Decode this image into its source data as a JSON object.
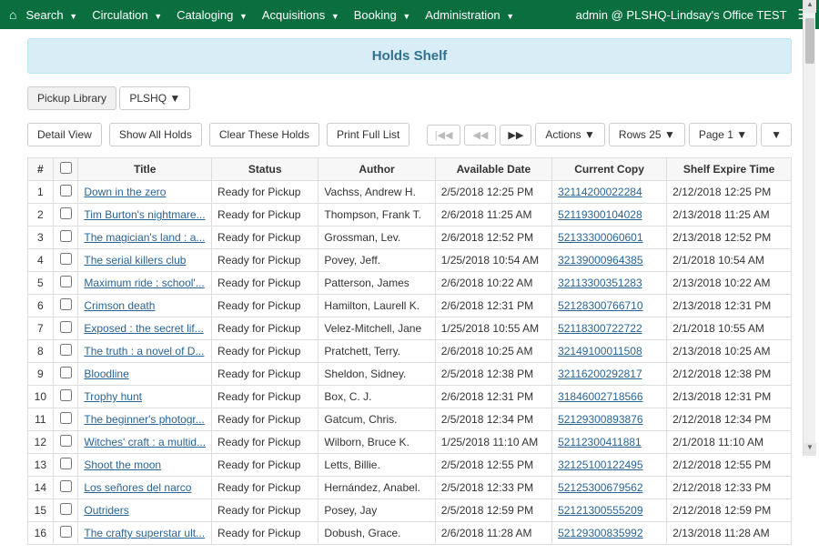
{
  "nav": {
    "items": [
      "Search",
      "Circulation",
      "Cataloging",
      "Acquisitions",
      "Booking",
      "Administration"
    ],
    "user_info": "admin @ PLSHQ-Lindsay's Office TEST"
  },
  "page_title": "Holds Shelf",
  "library_picker": {
    "label": "Pickup Library",
    "value": "PLSHQ"
  },
  "toolbar": {
    "detail_view": "Detail View",
    "show_all": "Show All Holds",
    "clear": "Clear These Holds",
    "print": "Print Full List",
    "actions": "Actions",
    "rows": "Rows 25",
    "page": "Page 1"
  },
  "columns": {
    "num": "#",
    "title": "Title",
    "status": "Status",
    "author": "Author",
    "avail": "Available Date",
    "copy": "Current Copy",
    "expire": "Shelf Expire Time"
  },
  "rows": [
    {
      "n": "1",
      "title": "Down in the zero",
      "status": "Ready for Pickup",
      "author": "Vachss, Andrew H.",
      "avail": "2/5/2018 12:25 PM",
      "copy": "32114200022284",
      "expire": "2/12/2018 12:25 PM"
    },
    {
      "n": "2",
      "title": "Tim Burton's nightmare...",
      "status": "Ready for Pickup",
      "author": "Thompson, Frank T.",
      "avail": "2/6/2018 11:25 AM",
      "copy": "52119300104028",
      "expire": "2/13/2018 11:25 AM"
    },
    {
      "n": "3",
      "title": "The magician's land : a...",
      "status": "Ready for Pickup",
      "author": "Grossman, Lev.",
      "avail": "2/6/2018 12:52 PM",
      "copy": "52133300060601",
      "expire": "2/13/2018 12:52 PM"
    },
    {
      "n": "4",
      "title": "The serial killers club",
      "status": "Ready for Pickup",
      "author": "Povey, Jeff.",
      "avail": "1/25/2018 10:54 AM",
      "copy": "32139000964385",
      "expire": "2/1/2018 10:54 AM"
    },
    {
      "n": "5",
      "title": "Maximum ride : school'...",
      "status": "Ready for Pickup",
      "author": "Patterson, James",
      "avail": "2/6/2018 10:22 AM",
      "copy": "32113300351283",
      "expire": "2/13/2018 10:22 AM"
    },
    {
      "n": "6",
      "title": "Crimson death",
      "status": "Ready for Pickup",
      "author": "Hamilton, Laurell K.",
      "avail": "2/6/2018 12:31 PM",
      "copy": "52128300766710",
      "expire": "2/13/2018 12:31 PM"
    },
    {
      "n": "7",
      "title": "Exposed : the secret lif...",
      "status": "Ready for Pickup",
      "author": "Velez-Mitchell, Jane",
      "avail": "1/25/2018 10:55 AM",
      "copy": "52118300722722",
      "expire": "2/1/2018 10:55 AM"
    },
    {
      "n": "8",
      "title": "The truth : a novel of D...",
      "status": "Ready for Pickup",
      "author": "Pratchett, Terry.",
      "avail": "2/6/2018 10:25 AM",
      "copy": "32149100011508",
      "expire": "2/13/2018 10:25 AM"
    },
    {
      "n": "9",
      "title": "Bloodline",
      "status": "Ready for Pickup",
      "author": "Sheldon, Sidney.",
      "avail": "2/5/2018 12:38 PM",
      "copy": "32116200292817",
      "expire": "2/12/2018 12:38 PM"
    },
    {
      "n": "10",
      "title": "Trophy hunt",
      "status": "Ready for Pickup",
      "author": "Box, C. J.",
      "avail": "2/6/2018 12:31 PM",
      "copy": "31846002718566",
      "expire": "2/13/2018 12:31 PM"
    },
    {
      "n": "11",
      "title": "The beginner's photogr...",
      "status": "Ready for Pickup",
      "author": "Gatcum, Chris.",
      "avail": "2/5/2018 12:34 PM",
      "copy": "52129300893876",
      "expire": "2/12/2018 12:34 PM"
    },
    {
      "n": "12",
      "title": "Witches' craft : a multid...",
      "status": "Ready for Pickup",
      "author": "Wilborn, Bruce K.",
      "avail": "1/25/2018 11:10 AM",
      "copy": "52112300411881",
      "expire": "2/1/2018 11:10 AM"
    },
    {
      "n": "13",
      "title": "Shoot the moon",
      "status": "Ready for Pickup",
      "author": "Letts, Billie.",
      "avail": "2/5/2018 12:55 PM",
      "copy": "32125100122495",
      "expire": "2/12/2018 12:55 PM"
    },
    {
      "n": "14",
      "title": "Los señores del narco",
      "status": "Ready for Pickup",
      "author": "Hernández, Anabel.",
      "avail": "2/5/2018 12:33 PM",
      "copy": "52125300679562",
      "expire": "2/12/2018 12:33 PM"
    },
    {
      "n": "15",
      "title": "Outriders",
      "status": "Ready for Pickup",
      "author": "Posey, Jay",
      "avail": "2/5/2018 12:59 PM",
      "copy": "52121300555209",
      "expire": "2/12/2018 12:59 PM"
    },
    {
      "n": "16",
      "title": "The crafty superstar ult...",
      "status": "Ready for Pickup",
      "author": "Dobush, Grace.",
      "avail": "2/6/2018 11:28 AM",
      "copy": "52129300835992",
      "expire": "2/13/2018 11:28 AM"
    }
  ]
}
